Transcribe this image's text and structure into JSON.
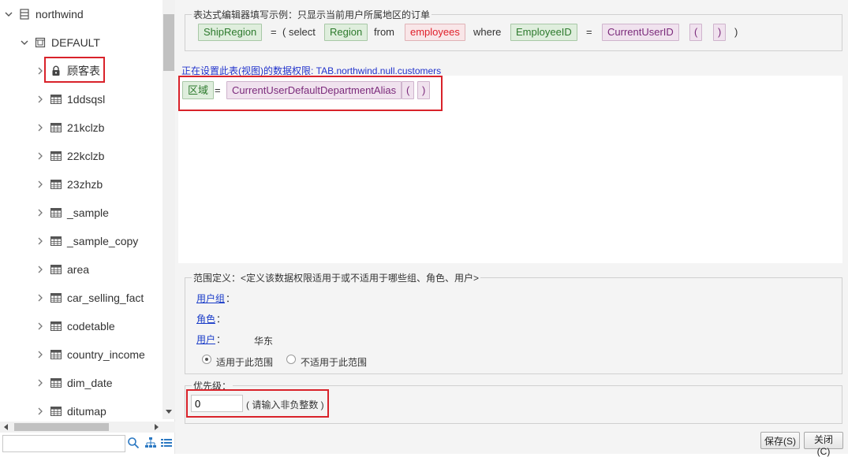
{
  "tree": {
    "root": {
      "label": "northwind",
      "icon": "database-icon"
    },
    "schema": {
      "label": "DEFAULT",
      "icon": "schema-icon"
    },
    "tables": [
      {
        "label": "顾客表",
        "icon": "lock-icon"
      },
      {
        "label": "1ddsqsl",
        "icon": "table-icon"
      },
      {
        "label": "21kclzb",
        "icon": "table-icon"
      },
      {
        "label": "22kclzb",
        "icon": "table-icon"
      },
      {
        "label": "23zhzb",
        "icon": "table-icon"
      },
      {
        "label": "_sample",
        "icon": "table-icon"
      },
      {
        "label": "_sample_copy",
        "icon": "table-icon"
      },
      {
        "label": "area",
        "icon": "table-icon"
      },
      {
        "label": "car_selling_fact",
        "icon": "table-icon"
      },
      {
        "label": "codetable",
        "icon": "table-icon"
      },
      {
        "label": "country_income",
        "icon": "table-icon"
      },
      {
        "label": "dim_date",
        "icon": "table-icon"
      },
      {
        "label": "ditumap",
        "icon": "table-icon"
      }
    ],
    "search_value": ""
  },
  "example": {
    "legend": "表达式编辑器填写示例：只显示当前用户所属地区的订单",
    "tokens": {
      "shipregion": "ShipRegion",
      "eq1": "=",
      "open_select": "( select",
      "region": "Region",
      "from": "from",
      "employees": "employees",
      "where": "where",
      "employeeid": "EmployeeID",
      "eq2": "=",
      "currentuserid": "CurrentUserID",
      "paren_open": "(",
      "paren_close": ")",
      "close": ")"
    }
  },
  "permission": {
    "title": "正在设置此表(视图)的数据权限: TAB.northwind.null.customers",
    "expr": {
      "field": "区域",
      "eq": "=",
      "func": "CurrentUserDefaultDepartmentAlias",
      "paren_open": "(",
      "paren_close": ")"
    }
  },
  "scope": {
    "legend": "范围定义：<定义该数据权限适用于或不适用于哪些组、角色、用户>",
    "group_label": "用户组",
    "role_label": "角色",
    "user_label": "用户",
    "colon": "：",
    "user_value": "华东",
    "apply_label": "适用于此范围",
    "not_apply_label": "不适用于此范围",
    "selected": "apply"
  },
  "priority": {
    "legend": "优先级：",
    "value": "0",
    "hint": "( 请输入非负整数 )"
  },
  "buttons": {
    "save": "保存(S)",
    "close": "关闭(C)"
  }
}
